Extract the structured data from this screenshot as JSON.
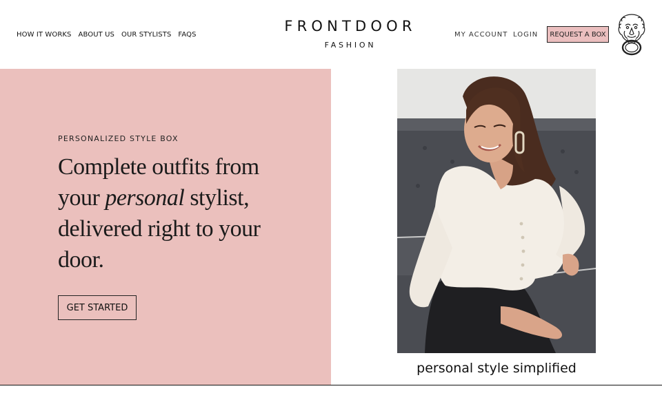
{
  "nav": {
    "left": [
      "HOW IT WORKS",
      "ABOUT US",
      "OUR STYLISTS",
      "FAQS"
    ],
    "my_account": "MY ACCOUNT",
    "login": "LOGIN",
    "request_box": "REQUEST A BOX"
  },
  "logo": {
    "main": "FRONTDOOR",
    "sub": "FASHION",
    "icon": "lion-door-knocker-icon"
  },
  "hero": {
    "eyebrow": "PERSONALIZED STYLE BOX",
    "headline_part1": "Complete outfits from your ",
    "headline_em": "personal",
    "headline_part2": " stylist, delivered right to your door.",
    "cta": "GET STARTED",
    "caption": "personal style simplified"
  },
  "colors": {
    "hero_bg": "#ebc0bd",
    "button_bg": "#ebbfbf",
    "text": "#111111"
  }
}
